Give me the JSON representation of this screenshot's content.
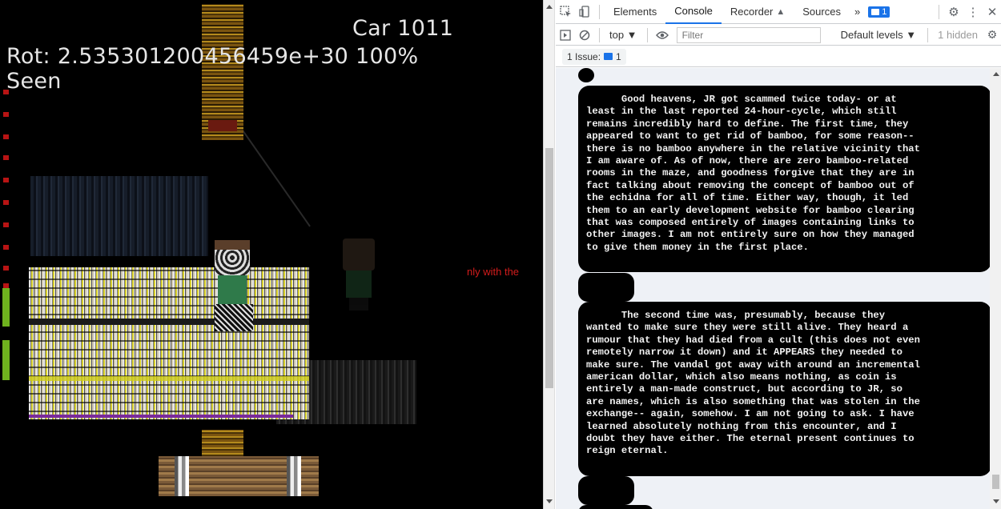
{
  "game": {
    "car_label": "Car 1011",
    "rot_label": "Rot: 2.535301200456459e+30 100%",
    "seen_label": "Seen",
    "partial_text": "nly with the"
  },
  "devtools": {
    "tabs": [
      {
        "label": "Elements"
      },
      {
        "label": "Console",
        "active": true
      },
      {
        "label": "Recorder"
      },
      {
        "label": "Sources"
      }
    ],
    "more_tabs": "»",
    "issues_badge": "1",
    "context": "top ▼",
    "filter_placeholder": "Filter",
    "levels": "Default levels ▼",
    "hidden_count": "1 hidden",
    "issue_label": "1 Issue:",
    "issue_count": "1",
    "messages": [
      "      Good heavens, JR got scammed twice today- or at\nleast in the last reported 24-hour-cycle, which still\nremains incredibly hard to define. The first time, they\nappeared to want to get rid of bamboo, for some reason--\nthere is no bamboo anywhere in the relative vicinity that\nI am aware of. As of now, there are zero bamboo-related\nrooms in the maze, and goodness forgive that they are in\nfact talking about removing the concept of bamboo out of\nthe echidna for all of time. Either way, though, it led\nthem to an early development website for bamboo clearing\nthat was composed entirely of images containing links to\nother images. I am not entirely sure on how they managed\nto give them money in the first place.",
      "      The second time was, presumably, because they\nwanted to make sure they were still alive. They heard a\nrumour that they had died from a cult (this does not even\nremotely narrow it down) and it APPEARS they needed to\nmake sure. The vandal got away with around an incremental\namerican dollar, which also means nothing, as coin is\nentirely a man-made construct, but according to JR, so\nare names, which is also something that was stolen in the\nexchange-- again, somehow. I am not going to ask. I have\nlearned absolutely nothing from this encounter, and I\ndoubt they have either. The eternal present continues to\nreign eternal."
    ],
    "colors": {
      "accent": "#1a73e8",
      "console_bg": "#eef1f6",
      "bubble_bg": "#000000"
    }
  }
}
